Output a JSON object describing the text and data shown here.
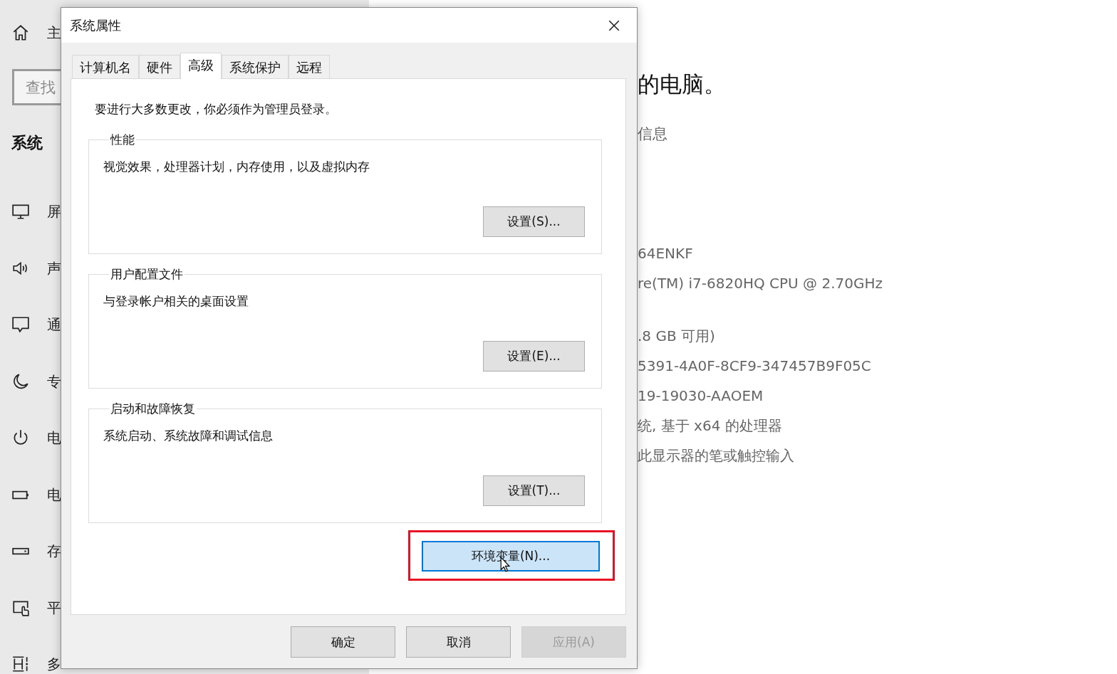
{
  "settings_sidebar": {
    "home_label": "主",
    "search": {
      "placeholder": "查找"
    },
    "section_title": "系统",
    "items": [
      {
        "kind": "display",
        "label": "屏"
      },
      {
        "kind": "sound",
        "label": "声"
      },
      {
        "kind": "notifications",
        "label": "通"
      },
      {
        "kind": "focus",
        "label": "专"
      },
      {
        "kind": "power",
        "label": "电"
      },
      {
        "kind": "battery",
        "label": "电"
      },
      {
        "kind": "storage",
        "label": "存"
      },
      {
        "kind": "tablet",
        "label": "平"
      },
      {
        "kind": "multitasking",
        "label": "多"
      }
    ]
  },
  "settings_content": {
    "heading": "的电脑。",
    "subheading": "信息",
    "lines": [
      "64ENKF",
      "re(TM) i7-6820HQ CPU @ 2.70GHz",
      ".8 GB 可用)",
      "5391-4A0F-8CF9-347457B9F05C",
      "19-19030-AAOEM",
      "统, 基于 x64 的处理器",
      "此显示器的笔或触控输入"
    ]
  },
  "dialog": {
    "title": "系统属性",
    "tabs": [
      {
        "label": "计算机名",
        "selected": false
      },
      {
        "label": "硬件",
        "selected": false
      },
      {
        "label": "高级",
        "selected": true
      },
      {
        "label": "系统保护",
        "selected": false
      },
      {
        "label": "远程",
        "selected": false
      }
    ],
    "notice": "要进行大多数更改，你必须作为管理员登录。",
    "groups": [
      {
        "title": "性能",
        "description": "视觉效果，处理器计划，内存使用，以及虚拟内存",
        "button": "设置(S)..."
      },
      {
        "title": "用户配置文件",
        "description": "与登录帐户相关的桌面设置",
        "button": "设置(E)..."
      },
      {
        "title": "启动和故障恢复",
        "description": "系统启动、系统故障和调试信息",
        "button": "设置(T)..."
      }
    ],
    "env_button": {
      "label": "环境变量(N)...",
      "highlighted": true,
      "hovered": true
    },
    "buttons": [
      {
        "label": "确定",
        "disabled": false
      },
      {
        "label": "取消",
        "disabled": false
      },
      {
        "label": "应用(A)",
        "disabled": true
      }
    ]
  }
}
